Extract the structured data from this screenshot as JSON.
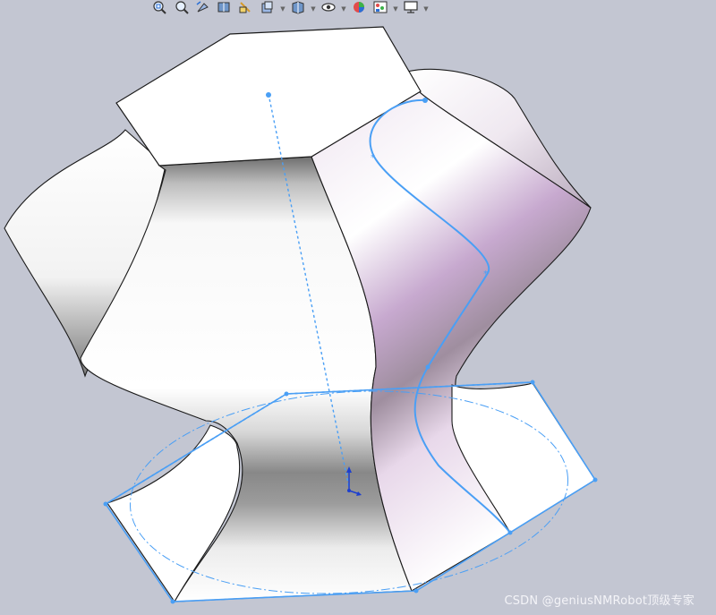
{
  "toolbar": {
    "items": [
      {
        "icon": "zoom-to-fit-icon",
        "caret": false
      },
      {
        "icon": "zoom-to-area-icon",
        "caret": false
      },
      {
        "icon": "previous-view-icon",
        "caret": false
      },
      {
        "icon": "section-view-icon",
        "caret": false
      },
      {
        "icon": "dynamic-annotation-icon",
        "caret": false
      },
      {
        "icon": "view-orientation-icon",
        "caret": true
      },
      {
        "icon": "display-style-icon",
        "caret": true
      },
      {
        "icon": "hide-show-items-icon",
        "caret": true
      },
      {
        "icon": "edit-appearance-icon",
        "caret": false
      },
      {
        "icon": "apply-scene-icon",
        "caret": true
      },
      {
        "icon": "view-settings-icon",
        "caret": true
      }
    ]
  },
  "colors": {
    "background": "#c3c6d2",
    "sketch": "#4a9ff5",
    "edge": "#1a1a1a",
    "face_light": "#ffffff",
    "face_shadow": "#8e8e8e",
    "face_tint": "#c9a9d6"
  },
  "watermark": "CSDN @geniusNMRobot顶级专家"
}
